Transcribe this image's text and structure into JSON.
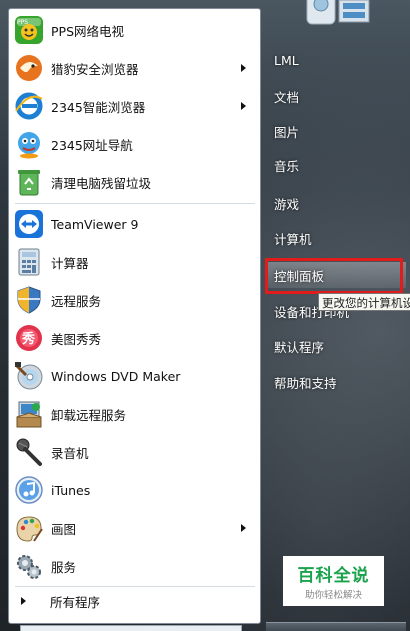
{
  "pinned_programs": [
    {
      "label": "PPS网络电视",
      "icon": "pps-tv-icon",
      "has_submenu": false
    },
    {
      "label": "猎豹安全浏览器",
      "icon": "cheetah-browser-icon",
      "has_submenu": true
    },
    {
      "label": "2345智能浏览器",
      "icon": "ie-2345-browser-icon",
      "has_submenu": true
    },
    {
      "label": "2345网址导航",
      "icon": "2345-navigation-icon",
      "has_submenu": false
    },
    {
      "label": "清理电脑残留垃圾",
      "icon": "recycle-cleanup-icon",
      "has_submenu": false
    }
  ],
  "recent_programs": [
    {
      "label": "TeamViewer 9",
      "icon": "teamviewer-icon",
      "has_submenu": false
    },
    {
      "label": "计算器",
      "icon": "calculator-icon",
      "has_submenu": false
    },
    {
      "label": "远程服务",
      "icon": "shield-icon",
      "has_submenu": false
    },
    {
      "label": "美图秀秀",
      "icon": "meitu-xiuxiu-icon",
      "has_submenu": false
    },
    {
      "label": "Windows DVD Maker",
      "icon": "dvd-maker-icon",
      "has_submenu": false
    },
    {
      "label": "卸载远程服务",
      "icon": "uninstall-icon",
      "has_submenu": false
    },
    {
      "label": "录音机",
      "icon": "microphone-icon",
      "has_submenu": false
    },
    {
      "label": "iTunes",
      "icon": "itunes-icon",
      "has_submenu": false
    },
    {
      "label": "画图",
      "icon": "paint-palette-icon",
      "has_submenu": true
    },
    {
      "label": "服务",
      "icon": "services-gears-icon",
      "has_submenu": false
    }
  ],
  "all_programs_label": "所有程序",
  "right_items": [
    {
      "label": "LML",
      "name": "user-folder-item"
    },
    {
      "label": "文档",
      "name": "documents-item"
    },
    {
      "label": "图片",
      "name": "pictures-item"
    },
    {
      "label": "音乐",
      "name": "music-item"
    },
    {
      "label": "游戏",
      "name": "games-item"
    },
    {
      "label": "计算机",
      "name": "computer-item"
    },
    {
      "label": "控制面板",
      "name": "control-panel-item"
    },
    {
      "label": "设备和打印机",
      "name": "devices-printers-item"
    },
    {
      "label": "默认程序",
      "name": "default-programs-item"
    },
    {
      "label": "帮助和支持",
      "name": "help-support-item"
    }
  ],
  "tooltip_text": "更改您的计算机设",
  "watermark": {
    "title": "百科全说",
    "subtitle": "助你轻松解决"
  },
  "colors": {
    "highlight": "#e21b1b",
    "watermark_green": "#1aa24c"
  }
}
